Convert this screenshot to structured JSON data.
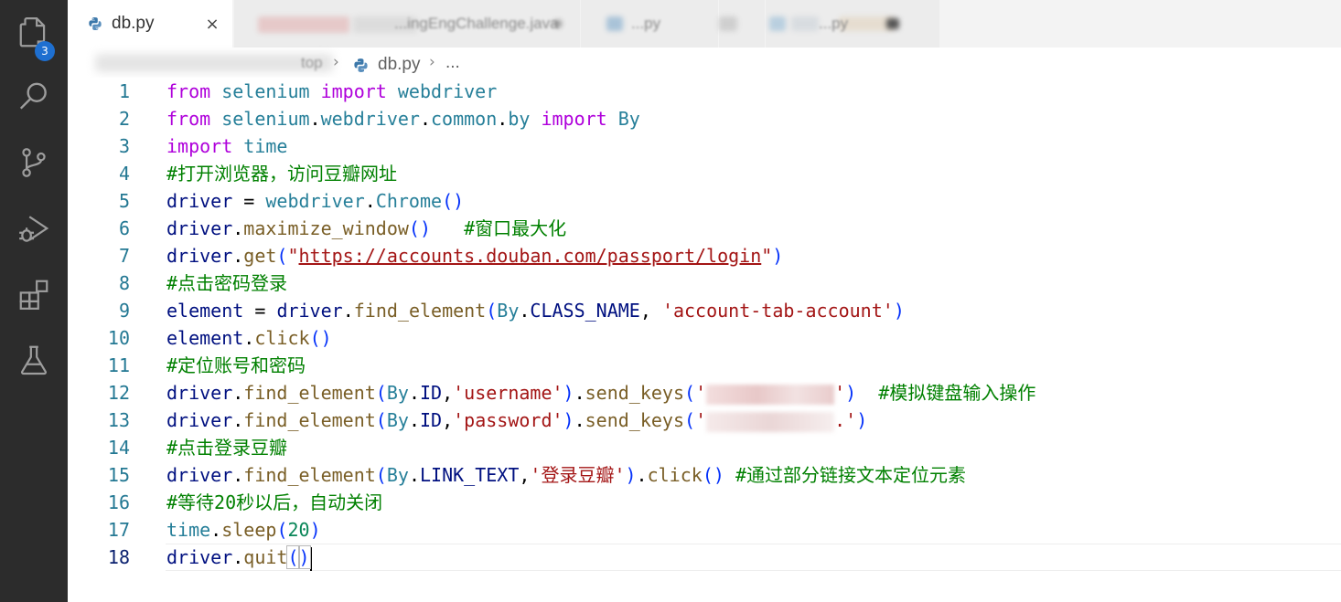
{
  "tabs": {
    "active": {
      "label": "db.py",
      "close_symbol": "×"
    },
    "inactive": [
      {
        "label": "...ingEngChallenge.java"
      },
      {
        "label": "...py"
      },
      {
        "label": ""
      },
      {
        "label": "...py"
      }
    ]
  },
  "activity_bar": {
    "explorer_badge": "3",
    "items": [
      "files-icon",
      "search-icon",
      "source-control-icon",
      "run-debug-icon",
      "extensions-icon",
      "testing-icon"
    ]
  },
  "breadcrumb": {
    "folder": "top",
    "file": "db.py",
    "more": "..."
  },
  "editor": {
    "language": "python",
    "current_line": 18,
    "lines": [
      {
        "num": "1"
      },
      {
        "num": "2"
      },
      {
        "num": "3"
      },
      {
        "num": "4"
      },
      {
        "num": "5"
      },
      {
        "num": "6"
      },
      {
        "num": "7"
      },
      {
        "num": "8"
      },
      {
        "num": "9"
      },
      {
        "num": "10"
      },
      {
        "num": "11"
      },
      {
        "num": "12"
      },
      {
        "num": "13"
      },
      {
        "num": "14"
      },
      {
        "num": "15"
      },
      {
        "num": "16"
      },
      {
        "num": "17"
      },
      {
        "num": "18"
      }
    ],
    "tokens": {
      "l1": [
        "from",
        "selenium",
        "import",
        "webdriver"
      ],
      "l2": [
        "from",
        "selenium",
        ".",
        "webdriver",
        ".",
        "common",
        ".",
        "by",
        "import",
        "By"
      ],
      "l3": [
        "import",
        "time"
      ],
      "l4": [
        "#打开浏览器，访问豆瓣网址"
      ],
      "l5": [
        "driver",
        "=",
        "webdriver",
        ".",
        "Chrome",
        "(",
        ")"
      ],
      "l6": [
        "driver",
        ".",
        "maximize_window",
        "(",
        ")",
        "#窗口最大化"
      ],
      "l7": [
        "driver",
        ".",
        "get",
        "(",
        "\"",
        "https://accounts.douban.com/passport/login",
        "\"",
        ")"
      ],
      "l8": [
        "#点击密码登录"
      ],
      "l9": [
        "element",
        "=",
        "driver",
        ".",
        "find_element",
        "(",
        "By",
        ".",
        "CLASS_NAME",
        ",",
        "'account-tab-account'",
        ")"
      ],
      "l10": [
        "element",
        ".",
        "click",
        "(",
        ")"
      ],
      "l11": [
        "#定位账号和密码"
      ],
      "l12": [
        "driver",
        ".",
        "find_element",
        "(",
        "By",
        ".",
        "ID",
        ",",
        "'username'",
        ")",
        ".",
        "send_keys",
        "(",
        "'",
        "'",
        ")",
        "#模拟键盘输入操作"
      ],
      "l13": [
        "driver",
        ".",
        "find_element",
        "(",
        "By",
        ".",
        "ID",
        ",",
        "'password'",
        ")",
        ".",
        "send_keys",
        "(",
        "'",
        ".'",
        ")"
      ],
      "l14": [
        "#点击登录豆瓣"
      ],
      "l15": [
        "driver",
        ".",
        "find_element",
        "(",
        "By",
        ".",
        "LINK_TEXT",
        ",",
        "'登录豆瓣'",
        ")",
        ".",
        "click",
        "(",
        ")",
        "#通过部分链接文本定位元素"
      ],
      "l16": [
        "#等待20秒以后，自动关闭"
      ],
      "l17": [
        "time",
        ".",
        "sleep",
        "(",
        "20",
        ")"
      ],
      "l18": [
        "driver",
        ".",
        "quit",
        "(",
        ")"
      ]
    }
  },
  "colors": {
    "activity_bar": "#2c2c2c",
    "badge": "#1e6fd0",
    "keyword": "#af00db",
    "module": "#267f99",
    "variable": "#001080",
    "function": "#795e26",
    "string": "#a31515",
    "comment": "#008000",
    "number": "#098658",
    "line_number": "#237893"
  }
}
